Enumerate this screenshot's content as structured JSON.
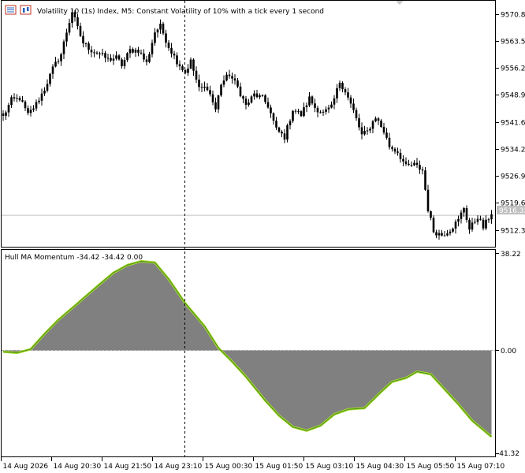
{
  "chart_header": {
    "title": "Volatility 10 (1s) Index, M5:  Constant Volatility of 10% with a tick every 1 second"
  },
  "indicator_header": {
    "label": "Hull MA Momentum -34.42 -34.42 0.00"
  },
  "colors": {
    "background": "#ffffff",
    "candle": "#000000",
    "price_line": "#c0c0c0",
    "price_tag_bg": "#c0c0c0",
    "price_tag_text": "#ffffff",
    "histogram_fill": "#808080",
    "momentum_line_outer": "#b0dc30",
    "momentum_line_inner": "#3c8c14",
    "zero_line": "#a0a0a0",
    "crosshair": "#000000",
    "axis": "#000000"
  },
  "price_axis": {
    "ticks": [
      "9570.84",
      "9563.53",
      "9556.22",
      "9548.91",
      "9541.60",
      "9534.29",
      "9526.98",
      "9519.67",
      "9512.36"
    ],
    "current_price_label": "9516.32",
    "range": [
      9507.8,
      9574.4
    ]
  },
  "indicator_axis": {
    "max_label": "38.22",
    "zero_label": "0.00",
    "min_label": "-41.32",
    "range": [
      -41.32,
      38.22
    ]
  },
  "time_axis": {
    "labels": [
      "14 Aug 2026",
      "14 Aug 20:30",
      "14 Aug 21:50",
      "14 Aug 23:10",
      "15 Aug 00:30",
      "15 Aug 01:50",
      "15 Aug 03:10",
      "15 Aug 04:30",
      "15 Aug 05:50",
      "15 Aug 07:10"
    ]
  },
  "chart_data": [
    {
      "type": "candlestick",
      "title": "Volatility 10 (1s) Index, M5:  Constant Volatility of 10% with a tick every 1 second",
      "ylim": [
        9507.8,
        9574.4
      ],
      "current_price": 9516.32,
      "keyframes": [
        [
          0,
          9543
        ],
        [
          3,
          9547.5
        ],
        [
          6,
          9548
        ],
        [
          9,
          9543.5
        ],
        [
          12,
          9546.5
        ],
        [
          15,
          9550.5
        ],
        [
          18,
          9556
        ],
        [
          21,
          9560
        ],
        [
          23,
          9566
        ],
        [
          25,
          9571.5
        ],
        [
          27,
          9567
        ],
        [
          29,
          9563
        ],
        [
          32,
          9561
        ],
        [
          35,
          9560
        ],
        [
          38,
          9558.5
        ],
        [
          41,
          9559
        ],
        [
          43,
          9557
        ],
        [
          46,
          9561
        ],
        [
          49,
          9561
        ],
        [
          52,
          9557.5
        ],
        [
          55,
          9566
        ],
        [
          57,
          9567.5
        ],
        [
          60,
          9562
        ],
        [
          63,
          9558
        ],
        [
          66,
          9555
        ],
        [
          68,
          9558
        ],
        [
          71,
          9550.5
        ],
        [
          74,
          9551
        ],
        [
          77,
          9545
        ],
        [
          79,
          9552
        ],
        [
          82,
          9554.5
        ],
        [
          85,
          9551
        ],
        [
          88,
          9546
        ],
        [
          91,
          9549
        ],
        [
          94,
          9548
        ],
        [
          96,
          9546
        ],
        [
          99,
          9539.5
        ],
        [
          102,
          9537.5
        ],
        [
          105,
          9545
        ],
        [
          108,
          9543.5
        ],
        [
          111,
          9548
        ],
        [
          113,
          9545.5
        ],
        [
          116,
          9544
        ],
        [
          119,
          9545.5
        ],
        [
          122,
          9552.5
        ],
        [
          124,
          9550
        ],
        [
          127,
          9544.5
        ],
        [
          130,
          9538
        ],
        [
          132,
          9539
        ],
        [
          135,
          9543
        ],
        [
          138,
          9539
        ],
        [
          140,
          9535
        ],
        [
          143,
          9533.5
        ],
        [
          146,
          9529.5
        ],
        [
          149,
          9530
        ],
        [
          152,
          9528.5
        ],
        [
          154,
          9518
        ],
        [
          156,
          9512
        ],
        [
          159,
          9511
        ],
        [
          162,
          9512.5
        ],
        [
          165,
          9515
        ],
        [
          167,
          9518.5
        ],
        [
          169,
          9512.5
        ],
        [
          172,
          9516
        ],
        [
          174,
          9513
        ],
        [
          177,
          9517
        ]
      ]
    },
    {
      "type": "area",
      "title": "Hull MA Momentum -34.42 -34.42 0.00",
      "ylim": [
        -41.32,
        38.22
      ],
      "x": [
        0,
        5,
        10,
        15,
        20,
        27,
        35,
        40,
        45,
        50,
        55,
        60,
        66,
        73,
        78,
        83,
        88,
        95,
        100,
        105,
        110,
        115,
        120,
        125,
        131,
        137,
        141,
        146,
        150,
        155,
        160,
        165,
        170,
        177
      ],
      "values": [
        -0.5,
        -1,
        0.5,
        6.5,
        12,
        18.5,
        26,
        30.5,
        33.5,
        35,
        34.5,
        28,
        18.5,
        9.5,
        1,
        -4.5,
        -10.5,
        -20,
        -26,
        -30.5,
        -32,
        -30,
        -25.5,
        -23.5,
        -23,
        -16.5,
        -12.5,
        -11,
        -8.5,
        -9.5,
        -15.5,
        -21.5,
        -28,
        -34.42
      ]
    }
  ]
}
